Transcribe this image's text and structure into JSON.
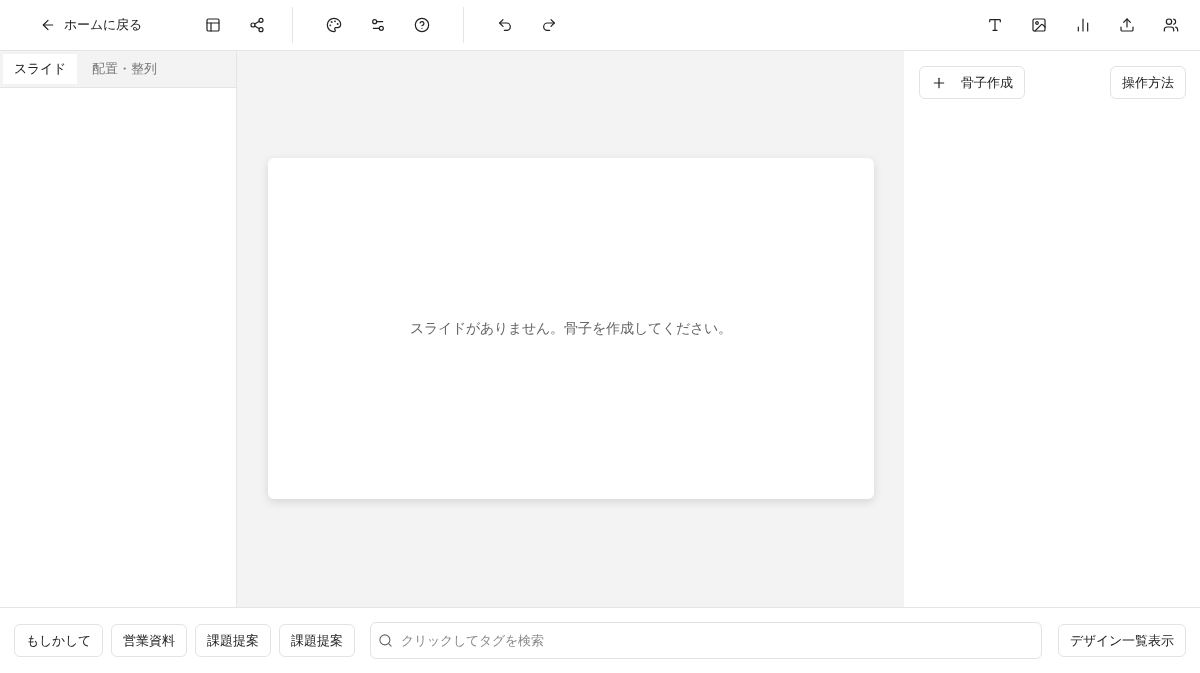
{
  "toolbar": {
    "back_label": "ホームに戻る"
  },
  "left_panel": {
    "tabs": [
      {
        "label": "スライド",
        "selected": true
      },
      {
        "label": "配置・整列",
        "selected": false
      }
    ]
  },
  "canvas": {
    "empty_message": "スライドがありません。骨子を作成してください。"
  },
  "right_panel": {
    "create_button": "骨子作成",
    "help_button": "操作方法"
  },
  "bottom_bar": {
    "tags": [
      "もしかして",
      "営業資料",
      "課題提案",
      "課題提案"
    ],
    "search": {
      "placeholder": "クリックしてタグを検索"
    },
    "design_button": "デザイン一覧表示"
  }
}
